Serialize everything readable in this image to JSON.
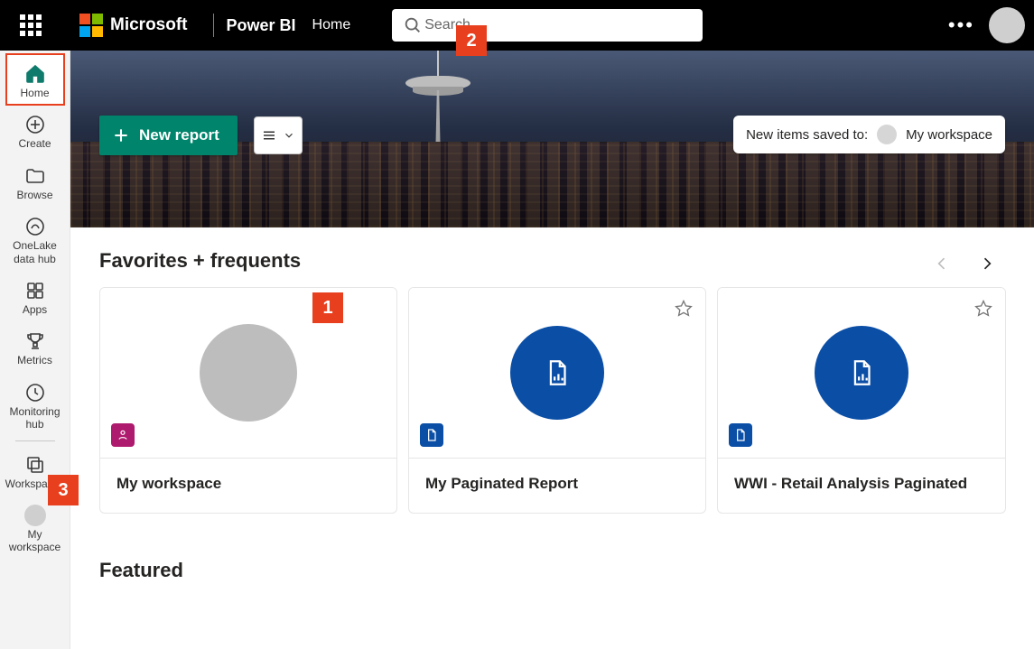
{
  "header": {
    "microsoft": "Microsoft",
    "product": "Power BI",
    "breadcrumb": "Home",
    "search_placeholder": "Search"
  },
  "sidebar": {
    "items": [
      {
        "id": "home",
        "label": "Home",
        "active": true
      },
      {
        "id": "create",
        "label": "Create",
        "active": false
      },
      {
        "id": "browse",
        "label": "Browse",
        "active": false
      },
      {
        "id": "onelake",
        "label": "OneLake\ndata hub",
        "active": false
      },
      {
        "id": "apps",
        "label": "Apps",
        "active": false
      },
      {
        "id": "metrics",
        "label": "Metrics",
        "active": false
      },
      {
        "id": "monitoring",
        "label": "Monitoring\nhub",
        "active": false
      },
      {
        "id": "workspaces",
        "label": "Workspaces",
        "active": false
      },
      {
        "id": "myws",
        "label": "My\nworkspace",
        "active": false
      }
    ]
  },
  "hero": {
    "new_report": "New report",
    "saved_to_prefix": "New items saved to:",
    "saved_to_target": "My workspace"
  },
  "sections": {
    "fav_title": "Favorites + frequents",
    "featured_title": "Featured"
  },
  "cards": [
    {
      "title": "My workspace",
      "kind": "workspace",
      "starred": false
    },
    {
      "title": "My Paginated Report",
      "kind": "paginated",
      "starred": false
    },
    {
      "title": "WWI - Retail Analysis Paginated",
      "kind": "paginated",
      "starred": false
    }
  ],
  "annotations": {
    "a1": "1",
    "a2": "2",
    "a3": "3"
  }
}
